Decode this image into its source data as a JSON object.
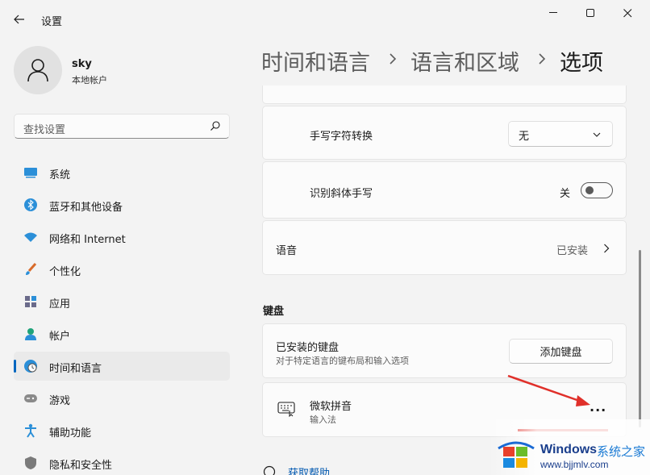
{
  "window": {
    "title": "设置"
  },
  "profile": {
    "name": "sky",
    "account_type": "本地帐户"
  },
  "search": {
    "placeholder": "查找设置"
  },
  "nav": {
    "items": [
      {
        "label": "系统",
        "icon": "system-icon"
      },
      {
        "label": "蓝牙和其他设备",
        "icon": "bluetooth-icon"
      },
      {
        "label": "网络和 Internet",
        "icon": "wifi-icon"
      },
      {
        "label": "个性化",
        "icon": "brush-icon"
      },
      {
        "label": "应用",
        "icon": "apps-icon"
      },
      {
        "label": "帐户",
        "icon": "account-icon"
      },
      {
        "label": "时间和语言",
        "icon": "time-language-icon",
        "selected": true
      },
      {
        "label": "游戏",
        "icon": "gamepad-icon"
      },
      {
        "label": "辅助功能",
        "icon": "accessibility-icon"
      },
      {
        "label": "隐私和安全性",
        "icon": "shield-icon"
      }
    ]
  },
  "breadcrumb": {
    "level1": "时间和语言",
    "level2": "语言和区域",
    "current": "选项"
  },
  "settings": {
    "handwriting_conversion": {
      "label": "手写字符转换",
      "value": "无"
    },
    "italic_handwriting": {
      "label": "识别斜体手写",
      "state": "关"
    },
    "speech": {
      "label": "语音",
      "status": "已安装"
    }
  },
  "keyboard": {
    "section_title": "键盘",
    "installed": {
      "label": "已安装的键盘",
      "description": "对于特定语言的键布局和输入选项",
      "add_button": "添加键盘"
    },
    "ime": {
      "name": "微软拼音",
      "type": "输入法",
      "more": "..."
    }
  },
  "help": {
    "label": "获取帮助"
  },
  "watermark": {
    "brand": "Windows",
    "suffix": "系统之家",
    "url": "www.bjjmlv.com"
  },
  "colors": {
    "accent": "#0067c0",
    "annotation_arrow": "#e0302a"
  }
}
